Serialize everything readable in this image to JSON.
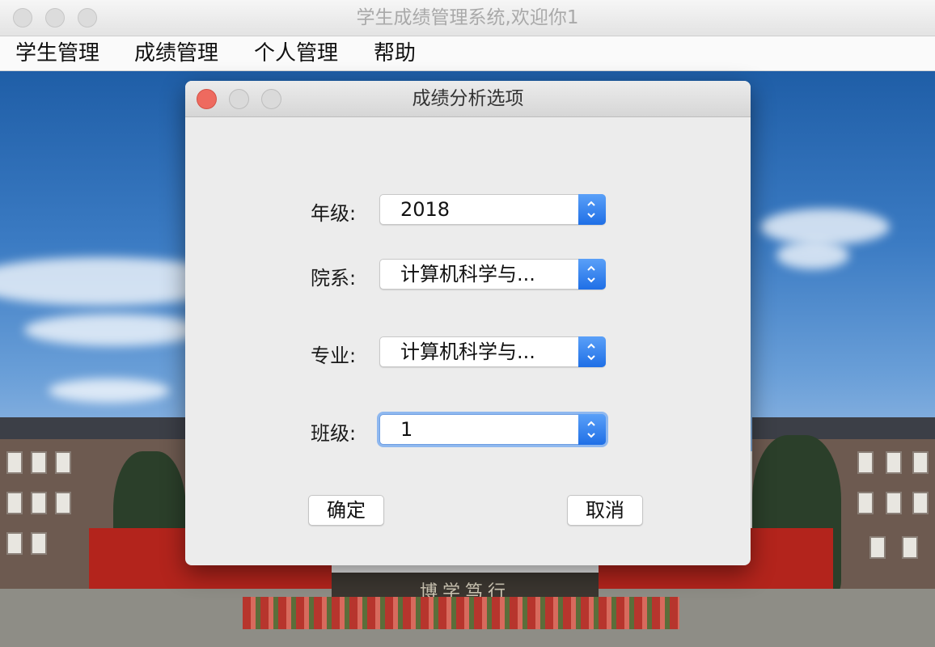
{
  "window": {
    "title": "学生成绩管理系统,欢迎你1"
  },
  "menu": [
    "学生管理",
    "成绩管理",
    "个人管理",
    "帮助"
  ],
  "background": {
    "stone_text": "博学笃行"
  },
  "dialog": {
    "title": "成绩分析选项",
    "fields": [
      {
        "label": "年级:",
        "value": "2018"
      },
      {
        "label": "院系:",
        "value": "计算机科学与..."
      },
      {
        "label": "专业:",
        "value": "计算机科学与..."
      },
      {
        "label": "班级:",
        "value": "1"
      }
    ],
    "ok_label": "确定",
    "cancel_label": "取消"
  },
  "colors": {
    "close": "#ee6a5f",
    "accent": "#1f6fe6"
  }
}
